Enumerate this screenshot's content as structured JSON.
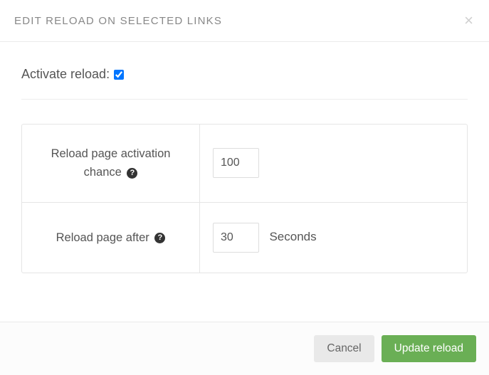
{
  "header": {
    "title": "EDIT RELOAD ON SELECTED LINKS",
    "close_glyph": "×"
  },
  "body": {
    "activate_label": "Activate reload:",
    "activate_checked": true,
    "rows": {
      "activation_chance": {
        "label": "Reload page activation chance",
        "value": "100",
        "help_glyph": "?"
      },
      "reload_after": {
        "label": "Reload page after",
        "value": "30",
        "unit": "Seconds",
        "help_glyph": "?"
      }
    }
  },
  "footer": {
    "cancel_label": "Cancel",
    "submit_label": "Update reload"
  }
}
